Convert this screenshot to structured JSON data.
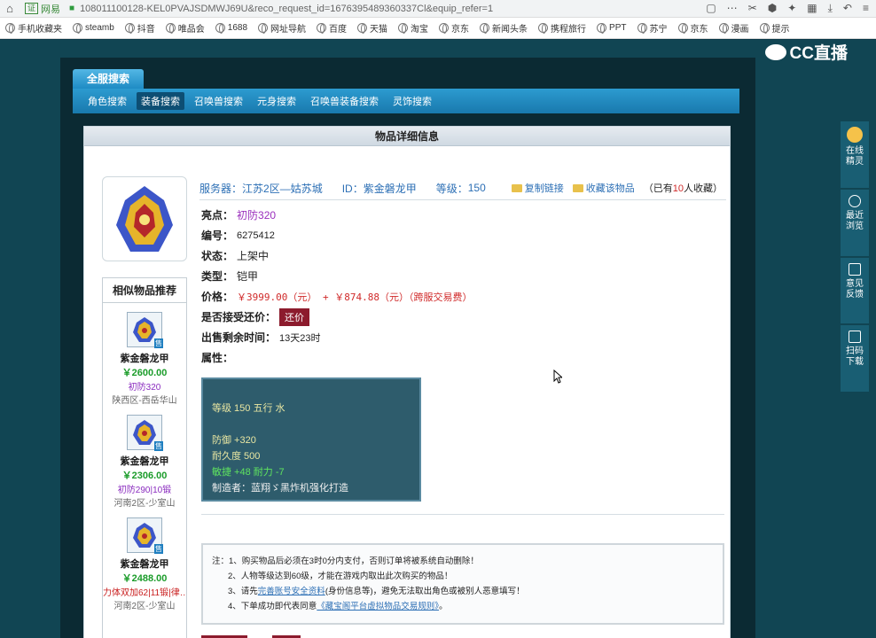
{
  "browser": {
    "site_label": "网易",
    "url": "108011100128-KEL0PVAJSDMWJ69U&reco_request_id=1676395489360337Cl&equip_refer=1",
    "bookmarks": [
      "手机收藏夹",
      "steamb",
      "抖音",
      "唯品会",
      "1688",
      "网址导航",
      "百度",
      "天猫",
      "淘宝",
      "京东",
      "新闻头条",
      "携程旅行",
      "PPT",
      "苏宁",
      "京东",
      "漫画",
      "提示"
    ]
  },
  "logo": {
    "text": "CC直播"
  },
  "nav": {
    "main_tab": "全服搜索",
    "sub_tabs": [
      "角色搜索",
      "装备搜索",
      "召唤兽搜索",
      "元身搜索",
      "召唤兽装备搜索",
      "灵饰搜索"
    ],
    "active_sub": "装备搜索"
  },
  "panel": {
    "title": "物品详细信息"
  },
  "item": {
    "server_label": "服务器：",
    "server": "江苏2区—姑苏城",
    "id_label": "ID：",
    "id_value": "紫金磐龙甲",
    "level_label": "等级：",
    "level_value": "150",
    "copy_link": "复制链接",
    "collect": "收藏该物品",
    "collect_count_prefix": "（已有",
    "collect_count": "10",
    "collect_count_suffix": "人收藏）"
  },
  "fields": {
    "highlight_k": "亮点：",
    "highlight_v": "初防320",
    "code_k": "编号：",
    "code_v": "6275412",
    "status_k": "状态：",
    "status_v": "上架中",
    "type_k": "类型：",
    "type_v": "铠甲",
    "price_k": "价格：",
    "price_v": "￥3999.00（元） + ￥874.88（元）（跨服交易费）",
    "counter_k": "是否接受还价：",
    "counter_btn": "还价",
    "remain_k": "出售剩余时间：",
    "remain_v": "13天23时",
    "attr_k": "属性："
  },
  "attributes": {
    "line1": "等级 150  五行 水",
    "line2": "防御 +320",
    "line3": "耐久度 500",
    "line4": "敏捷 +48 耐力 -7",
    "line5": "制造者：蓝翔ゞ黑炸机强化打造"
  },
  "similar": {
    "heading": "相似物品推荐",
    "items": [
      {
        "name": "紫金磐龙甲",
        "price": "￥2600.00",
        "tag": "初防320",
        "loc": "陕西区-西岳华山"
      },
      {
        "name": "紫金磐龙甲",
        "price": "￥2306.00",
        "tag": "初防290|10锻",
        "loc": "河南2区-少室山"
      },
      {
        "name": "紫金磐龙甲",
        "price": "￥2488.00",
        "tag": "力体双加62|11锻|律…",
        "loc": "河南2区-少室山"
      }
    ],
    "sold_badge": "售"
  },
  "notice": {
    "line1": "注：1、购买物品后必须在3时0分内支付，否则订单将被系统自动删除！",
    "line2": "2、人物等级达到60级，才能在游戏内取出此次购买的物品！",
    "line3_prefix": "3、请先",
    "line3_link": "完善账号安全资料",
    "line3_suffix": "(身份信息等)，避免无法取出角色或被别人恶意填写！",
    "line4_prefix": "4、下单成功即代表同意",
    "line4_link": "《藏宝阁平台虚拟物品交易规则》",
    "line4_suffix": "。"
  },
  "floatbar": {
    "items": [
      "在线精灵",
      "最近浏览",
      "意见反馈",
      "扫码下载"
    ]
  }
}
